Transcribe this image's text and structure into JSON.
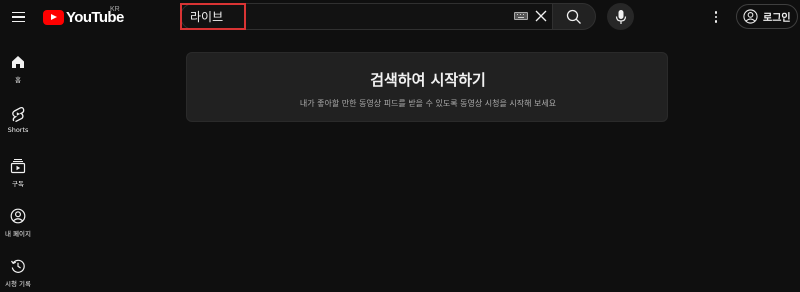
{
  "header": {
    "logo_text": "YouTube",
    "region_code": "KR",
    "search_value": "라이브",
    "login_label": "로그인"
  },
  "sidebar": {
    "items": [
      {
        "label": "홈",
        "icon": "home-icon"
      },
      {
        "label": "Shorts",
        "icon": "shorts-icon"
      },
      {
        "label": "구독",
        "icon": "subscriptions-icon"
      },
      {
        "label": "내 페이지",
        "icon": "you-icon"
      },
      {
        "label": "시청 기록",
        "icon": "history-icon"
      }
    ]
  },
  "main": {
    "prompt_title": "검색하여 시작하기",
    "prompt_subtitle": "내가 좋아할 만한 동영상 피드를 받을 수 있도록 동영상 시청을 시작해 보세요"
  },
  "colors": {
    "background": "#0f0f0f",
    "card": "#212121",
    "brand_red": "#ff0000",
    "highlight": "#d93434"
  }
}
